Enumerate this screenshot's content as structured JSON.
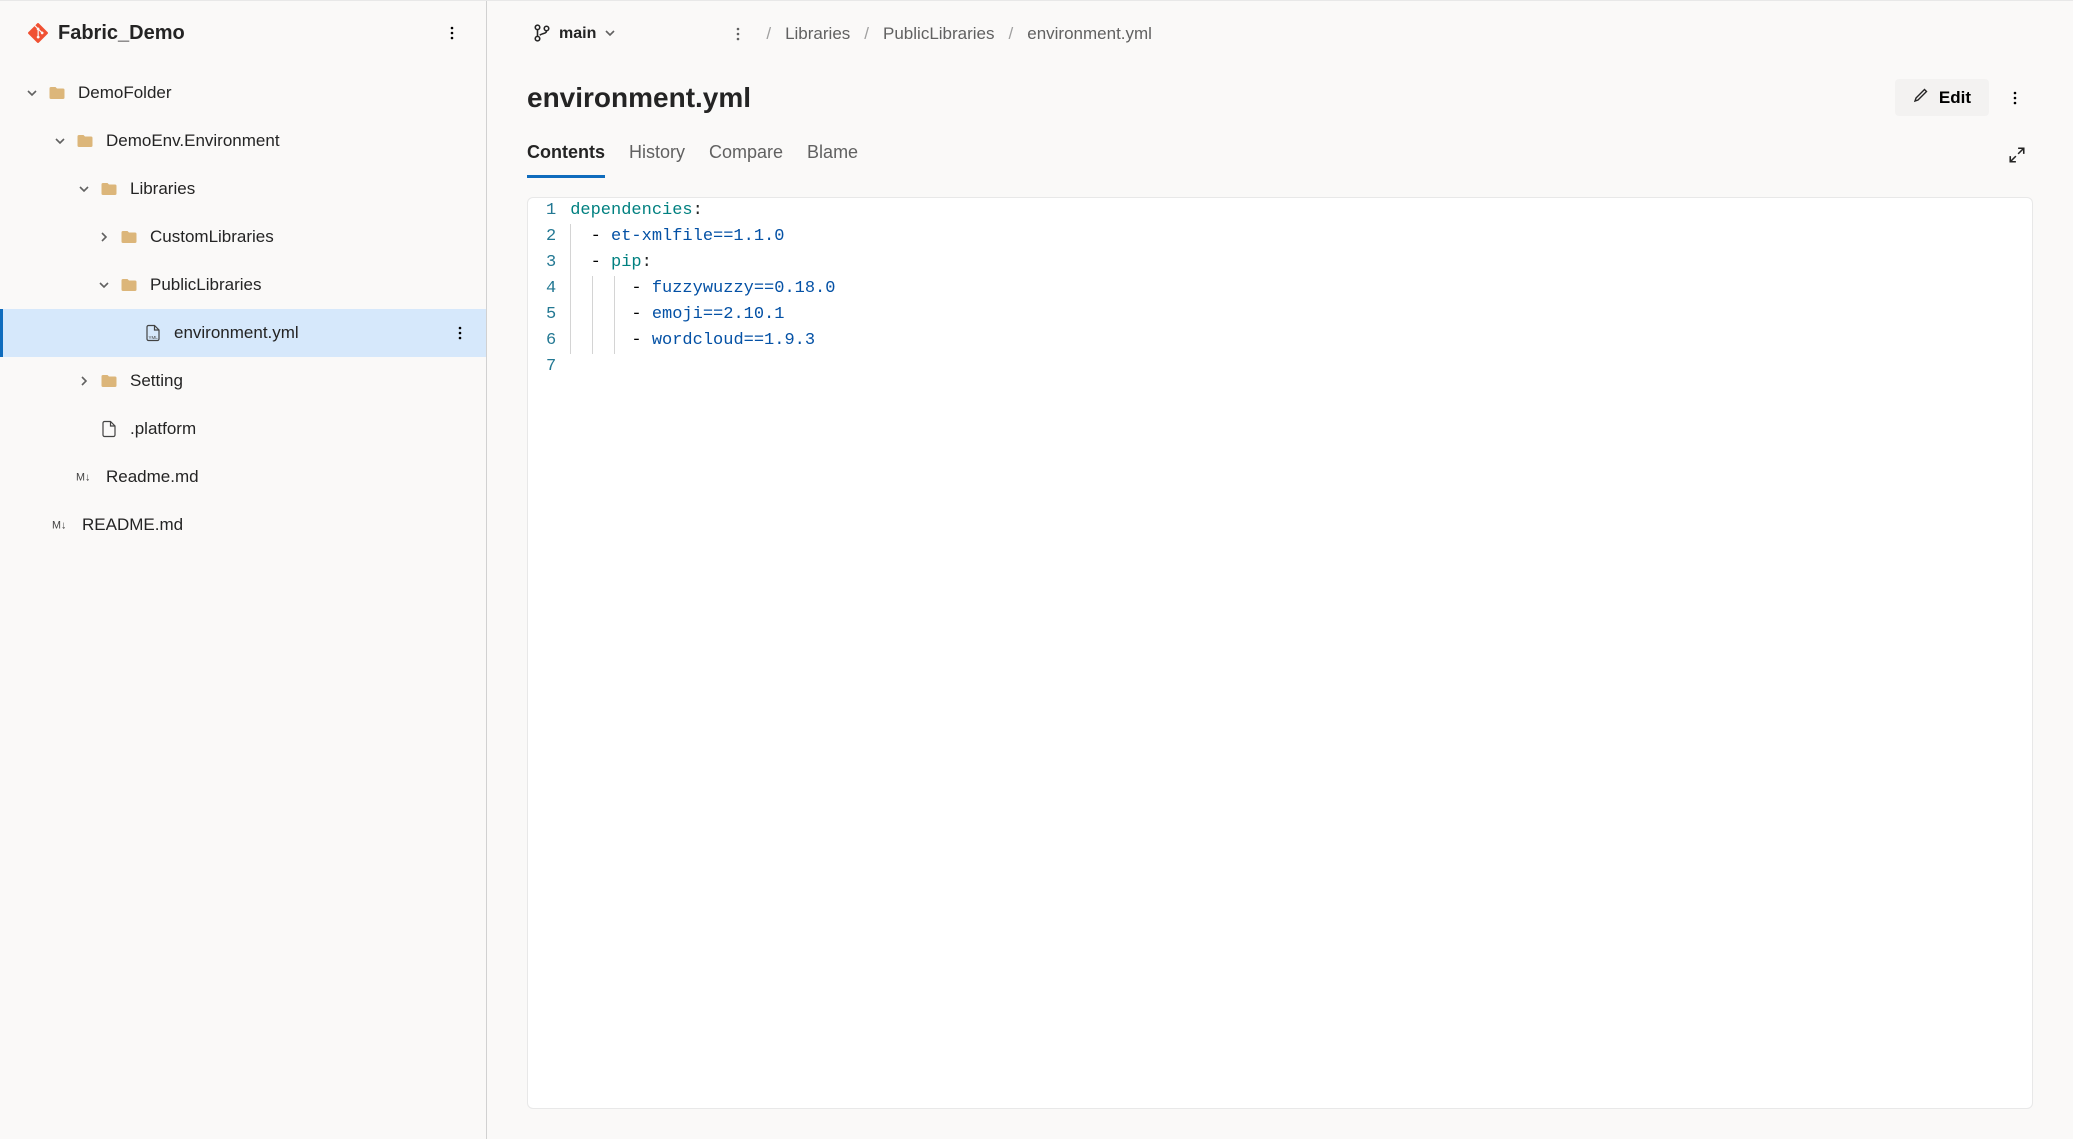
{
  "repo": {
    "name": "Fabric_Demo"
  },
  "branch": {
    "name": "main"
  },
  "tree": {
    "demo_folder": "DemoFolder",
    "demo_env": "DemoEnv.Environment",
    "libraries": "Libraries",
    "custom_libs": "CustomLibraries",
    "public_libs": "PublicLibraries",
    "env_yml": "environment.yml",
    "setting": "Setting",
    "platform": ".platform",
    "readme1": "Readme.md",
    "readme2": "README.md"
  },
  "breadcrumbs": {
    "seg1": "Libraries",
    "seg2": "PublicLibraries",
    "seg3": "environment.yml"
  },
  "file": {
    "title": "environment.yml",
    "edit_label": "Edit"
  },
  "tabs": {
    "contents": "Contents",
    "history": "History",
    "compare": "Compare",
    "blame": "Blame"
  },
  "code": {
    "lines": {
      "n1": "1",
      "n2": "2",
      "n3": "3",
      "n4": "4",
      "n5": "5",
      "n6": "6",
      "n7": "7"
    },
    "l1_key": "dependencies",
    "l2_val": "et-xmlfile==1.1.0",
    "l3_key": "pip",
    "l4_val": "fuzzywuzzy==0.18.0",
    "l5_val": "emoji==2.10.1",
    "l6_val": "wordcloud==1.9.3"
  }
}
